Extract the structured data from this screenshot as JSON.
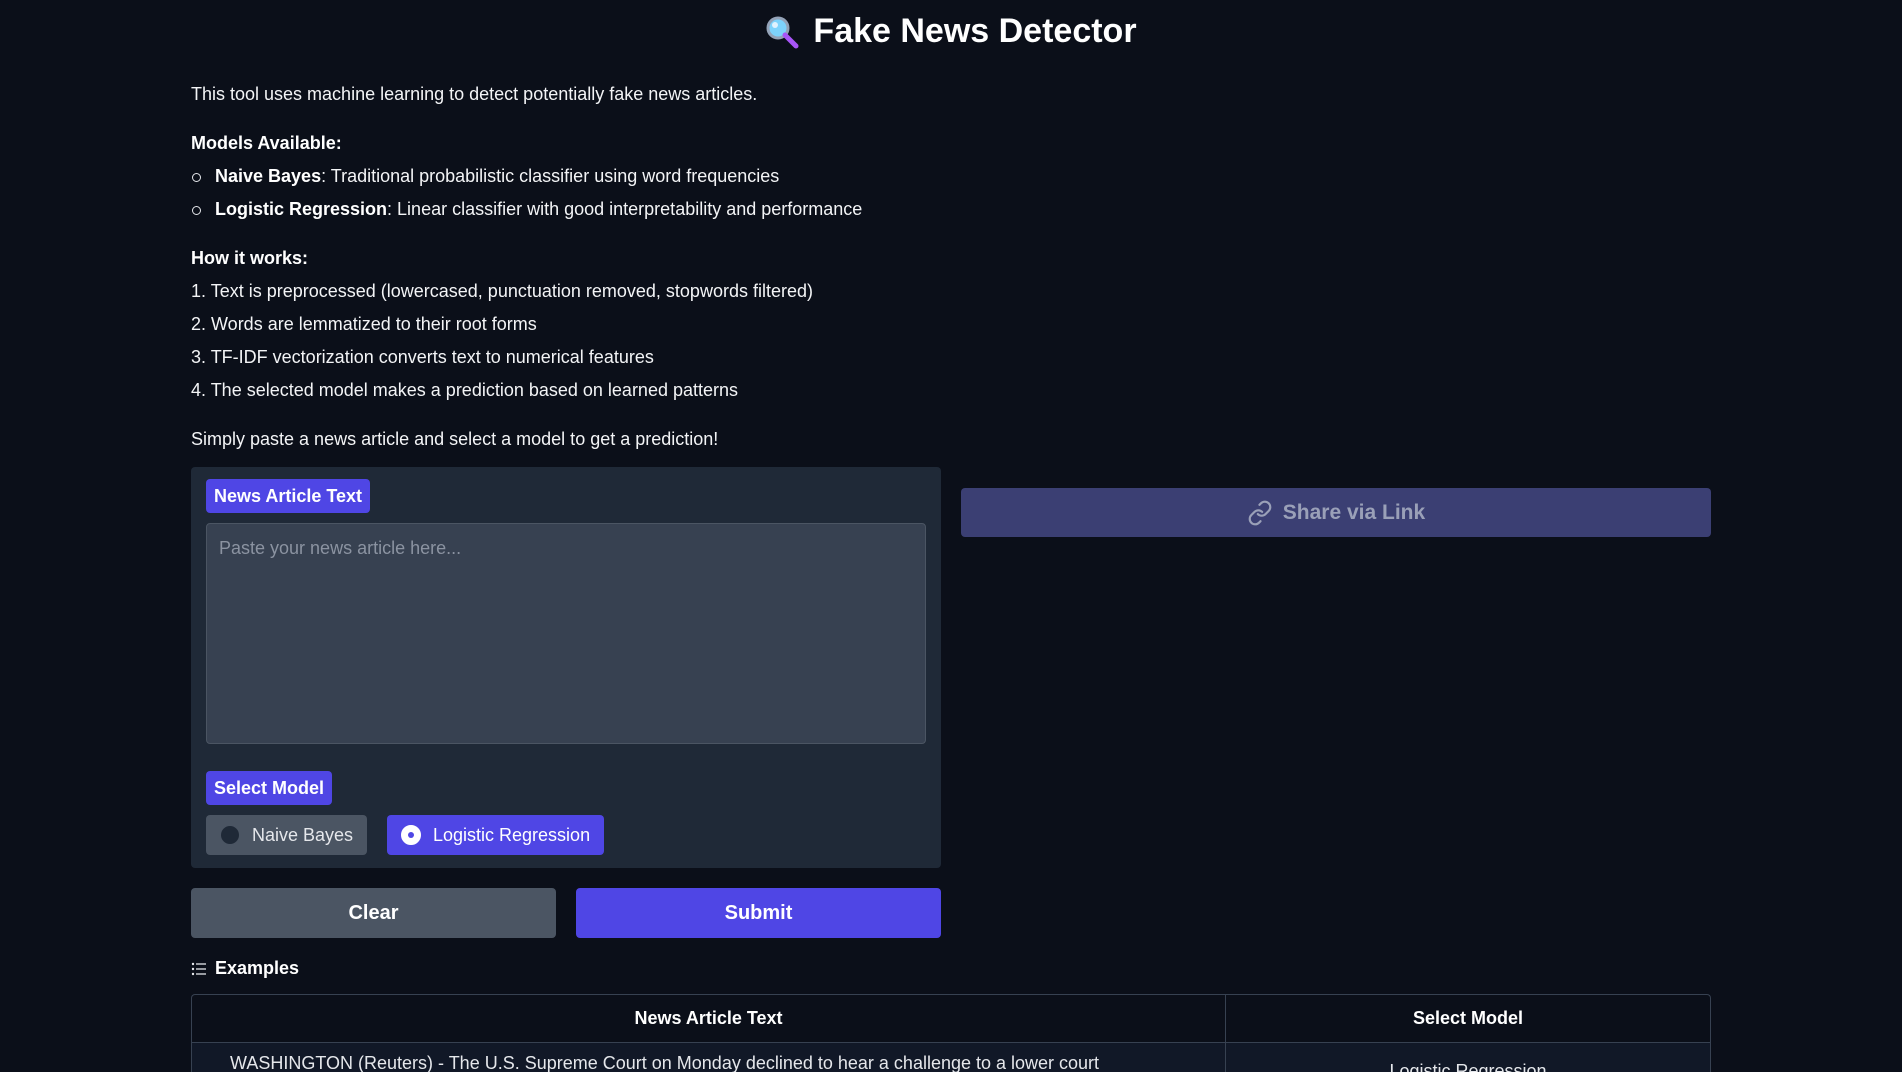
{
  "header": {
    "title": "Fake News Detector",
    "icon": "magnifying-glass-icon"
  },
  "description": {
    "intro": "This tool uses machine learning to detect potentially fake news articles.",
    "models_heading": "Models Available:",
    "models": [
      {
        "name": "Naive Bayes",
        "desc": ": Traditional probabilistic classifier using word frequencies"
      },
      {
        "name": "Logistic Regression",
        "desc": ": Linear classifier with good interpretability and performance"
      }
    ],
    "how_heading": "How it works:",
    "steps": [
      "1. Text is preprocessed (lowercased, punctuation removed, stopwords filtered)",
      "2. Words are lemmatized to their root forms",
      "3. TF-IDF vectorization converts text to numerical features",
      "4. The selected model makes a prediction based on learned patterns"
    ],
    "outro": "Simply paste a news article and select a model to get a prediction!"
  },
  "input": {
    "article_label": "News Article Text",
    "article_placeholder": "Paste your news article here...",
    "article_value": "",
    "model_label": "Select Model",
    "options": [
      "Naive Bayes",
      "Logistic Regression"
    ],
    "selected": "Logistic Regression"
  },
  "buttons": {
    "clear": "Clear",
    "submit": "Submit"
  },
  "share": {
    "label": "Share via Link",
    "icon": "link-icon"
  },
  "examples": {
    "label": "Examples",
    "icon": "list-icon",
    "headers": [
      "News Article Text",
      "Select Model"
    ],
    "rows": [
      {
        "text": "WASHINGTON (Reuters) - The U.S. Supreme Court on Monday declined to hear a challenge to a lower court",
        "model": "Logistic Regression"
      }
    ]
  },
  "colors": {
    "background": "#0b0f19",
    "panel": "#1f2937",
    "accent": "#4f46e5",
    "share_bg": "#3b3f73"
  }
}
